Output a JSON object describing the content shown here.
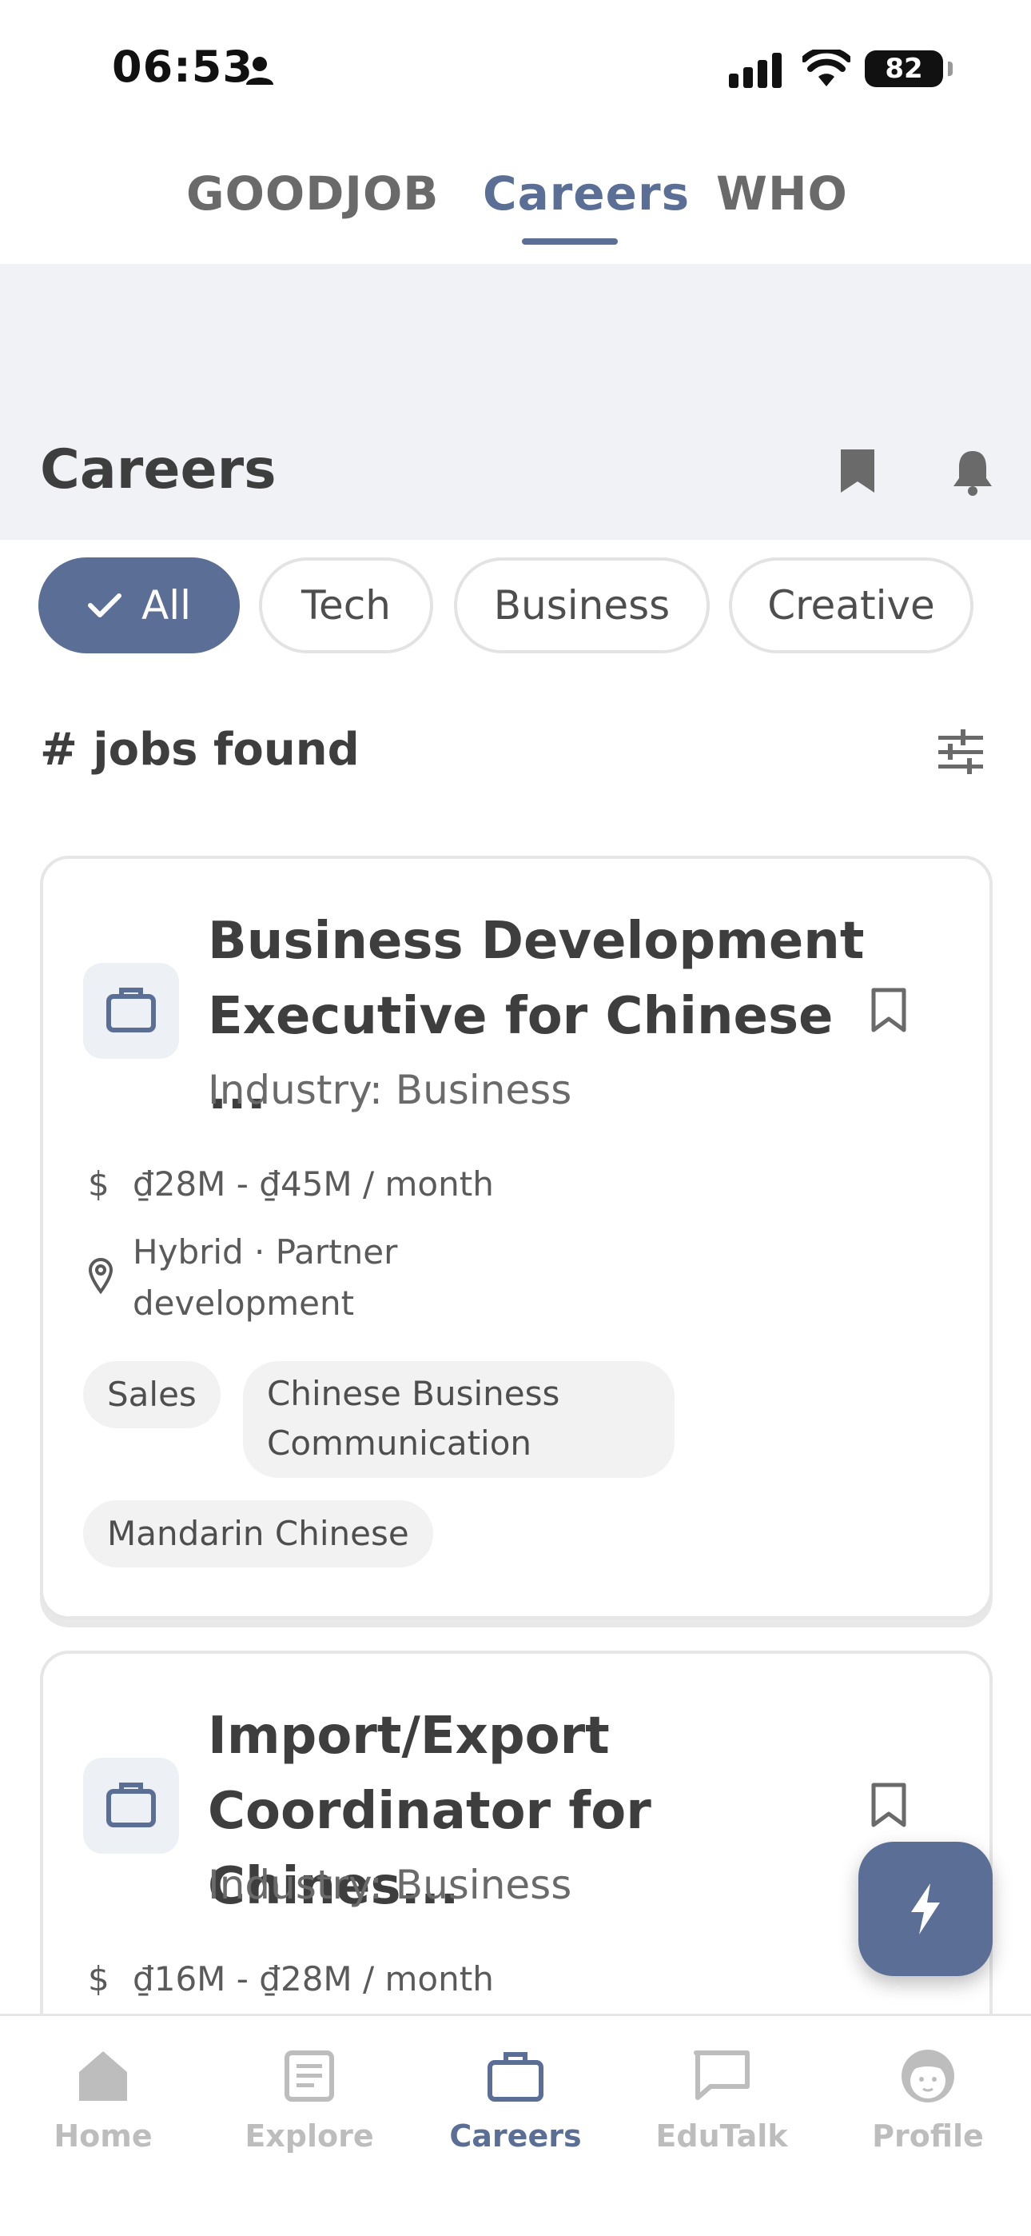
{
  "status_bar": {
    "time": "06:53",
    "battery": "82"
  },
  "top_nav": {
    "tabs": [
      "GOODJOB",
      "Careers",
      "WHO"
    ],
    "active": "Careers"
  },
  "header": {
    "title": "Careers"
  },
  "filters": {
    "chips": [
      "All",
      "Tech",
      "Business",
      "Creative"
    ],
    "active": "All"
  },
  "results": {
    "count_label": "# jobs found"
  },
  "jobs": [
    {
      "title_line1": "Business Development",
      "title_line2": "Executive for Chinese ...",
      "industry": "Industry: Business",
      "salary": "₫28M - ₫45M / month",
      "location_line1": "Hybrid · Partner",
      "location_line2": "development",
      "tags": [
        "Sales",
        "Chinese Business",
        "Communication",
        "Mandarin Chinese"
      ]
    },
    {
      "title_line1": "Import/Export",
      "title_line2": "Coordinator for Chines...",
      "industry": "Industry: Business",
      "salary": "₫16M - ₫28M / month"
    }
  ],
  "bottom_nav": {
    "items": [
      "Home",
      "Explore",
      "Careers",
      "EduTalk",
      "Profile"
    ],
    "active": "Careers"
  },
  "colors": {
    "accent": "#5b6f96",
    "header_bg": "#f1f2f6",
    "inactive": "#bdbdbd"
  }
}
